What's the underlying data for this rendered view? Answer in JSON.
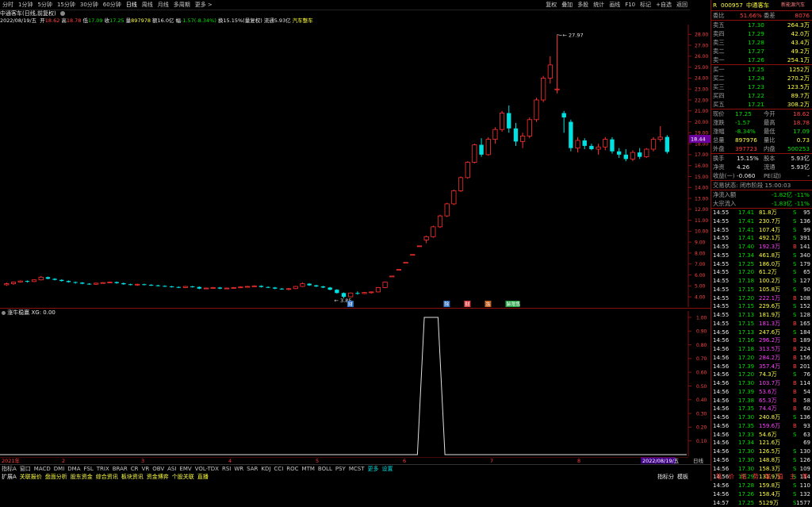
{
  "top_tabs": [
    "分时",
    "1分钟",
    "5分钟",
    "15分钟",
    "30分钟",
    "60分钟",
    "日线",
    "周线",
    "月线",
    "多周期",
    "更多 >"
  ],
  "toolbar": [
    "复权",
    "叠加",
    "多股",
    "统计",
    "画线",
    "F10",
    "标记",
    "+自选",
    "返回"
  ],
  "chart_title": "中通客车(日线,前复权)",
  "info_date": "2022/08/19/五",
  "info_items": [
    {
      "label": "开",
      "value": "18.62",
      "color": "red"
    },
    {
      "label": "高",
      "value": "18.78",
      "color": "red"
    },
    {
      "label": "低",
      "value": "17.09",
      "color": "green"
    },
    {
      "label": "收",
      "value": "17.25",
      "color": "green"
    },
    {
      "label": "量",
      "value": "897978",
      "color": "yellow"
    },
    {
      "label": "额",
      "value": "16.0亿",
      "color": "white"
    },
    {
      "label": "幅",
      "value": "-1.57(-8.34%)",
      "color": "green"
    },
    {
      "label": "换",
      "value": "15.15%(量复权)",
      "color": "white"
    },
    {
      "label": "流通",
      "value": "5.93亿",
      "color": "white"
    },
    {
      "label": "",
      "value": "汽车整车",
      "color": "yellow"
    }
  ],
  "price_axis": [
    "28.00",
    "27.00",
    "26.00",
    "25.00",
    "24.00",
    "23.00",
    "22.00",
    "21.00",
    "20.00",
    "19.00",
    "18.00",
    "17.00",
    "16.00",
    "15.00",
    "14.00",
    "13.00",
    "12.00",
    "11.00",
    "10.00",
    "9.00",
    "8.00",
    "7.00",
    "6.00",
    "5.00",
    "4.00"
  ],
  "current_price_tag": "18.44",
  "max_price_label": "27.97",
  "min_price_label": "3.85",
  "event_markers": [
    "财",
    "除",
    "财",
    "冻",
    "解限售"
  ],
  "indicator": {
    "name": "涨牛稳赢",
    "value": "XG: 0.00",
    "axis": [
      "1.00",
      "0.90",
      "0.80",
      "0.70",
      "0.60",
      "0.50",
      "0.40",
      "0.30",
      "0.20",
      "0.10"
    ]
  },
  "x_axis_labels": [
    "2021年",
    "2",
    "3",
    "4",
    "5",
    "6",
    "7",
    "8"
  ],
  "x_axis_current": "2022/08/19/五",
  "indicator_tabs": [
    "指标A",
    "窗口",
    "MACD",
    "DMI",
    "DMA",
    "FSL",
    "TRIX",
    "BRAR",
    "CR",
    "VR",
    "OBV",
    "ASI",
    "EMV",
    "VOL-TDX",
    "RSI",
    "WR",
    "SAR",
    "KDJ",
    "CCI",
    "ROC",
    "MTM",
    "BOLL",
    "PSY",
    "MCST",
    "更多",
    "设置"
  ],
  "bottom_tabs": [
    "扩展A",
    "关联报价",
    "盘面分析",
    "股东资金",
    "综合资讯",
    "板块资讯",
    "资金博弈",
    "个股关联",
    "直播"
  ],
  "bottom_right": [
    "指标分",
    "模板"
  ],
  "right_panel": {
    "code": "000957",
    "name": "中通客车",
    "sector": "新能源汽车",
    "weibi": {
      "label": "委比",
      "value": "51.66%",
      "label2": "委差",
      "value2": "8076"
    },
    "asks": [
      {
        "label": "卖五",
        "price": "17.30",
        "vol": "264.3万"
      },
      {
        "label": "卖四",
        "price": "17.29",
        "vol": "42.0万"
      },
      {
        "label": "卖三",
        "price": "17.28",
        "vol": "43.4万"
      },
      {
        "label": "卖二",
        "price": "17.27",
        "vol": "49.2万"
      },
      {
        "label": "卖一",
        "price": "17.26",
        "vol": "254.1万"
      }
    ],
    "bids": [
      {
        "label": "买一",
        "price": "17.25",
        "vol": "1252万"
      },
      {
        "label": "买二",
        "price": "17.24",
        "vol": "270.2万"
      },
      {
        "label": "买三",
        "price": "17.23",
        "vol": "123.5万"
      },
      {
        "label": "买四",
        "price": "17.22",
        "vol": "89.7万"
      },
      {
        "label": "买五",
        "price": "17.21",
        "vol": "308.2万"
      }
    ],
    "stats": [
      {
        "l1": "现价",
        "v1": "17.25",
        "c1": "green",
        "l2": "今开",
        "v2": "18.62",
        "c2": "red"
      },
      {
        "l1": "涨跌",
        "v1": "-1.57",
        "c1": "green",
        "l2": "最高",
        "v2": "18.78",
        "c2": "red"
      },
      {
        "l1": "涨幅",
        "v1": "-8.34%",
        "c1": "green",
        "l2": "最低",
        "v2": "17.09",
        "c2": "green"
      },
      {
        "l1": "总量",
        "v1": "897976",
        "c1": "yellow",
        "l2": "量比",
        "v2": "0.73",
        "c2": "yellow"
      },
      {
        "l1": "外盘",
        "v1": "397723",
        "c1": "red",
        "l2": "内盘",
        "v2": "500253",
        "c2": "green"
      }
    ],
    "stats2": [
      {
        "l1": "换手",
        "v1": "15.15%",
        "l2": "股本",
        "v2": "5.93亿"
      },
      {
        "l1": "净资",
        "v1": "4.26",
        "l2": "流通",
        "v2": "5.93亿"
      },
      {
        "l1": "收益(一)",
        "v1": "-0.060",
        "l2": "PE(动)",
        "v2": "-"
      }
    ],
    "trade_status": "交易状态: 闭市阶段 15:00:03",
    "flows": [
      {
        "label": "净流入额",
        "v1": "-1.82亿",
        "v2": "-11%"
      },
      {
        "label": "大宗流入",
        "v1": "-1.83亿",
        "v2": "-11%"
      }
    ],
    "ticks": [
      {
        "t": "14:55",
        "p": "17.41",
        "v": "81.8万",
        "s": "S",
        "n": "95"
      },
      {
        "t": "14:55",
        "p": "17.41",
        "v": "230.7万",
        "s": "S",
        "n": "136"
      },
      {
        "t": "14:55",
        "p": "17.41",
        "v": "107.4万",
        "s": "S",
        "n": "99"
      },
      {
        "t": "14:55",
        "p": "17.41",
        "v": "492.1万",
        "s": "S",
        "n": "391"
      },
      {
        "t": "14:55",
        "p": "17.40",
        "v": "192.3万",
        "s": "B",
        "n": "141"
      },
      {
        "t": "14:55",
        "p": "17.34",
        "v": "461.8万",
        "s": "S",
        "n": "340"
      },
      {
        "t": "14:55",
        "p": "17.25",
        "v": "186.0万",
        "s": "S",
        "n": "179"
      },
      {
        "t": "14:55",
        "p": "17.20",
        "v": "61.2万",
        "s": "S",
        "n": "65"
      },
      {
        "t": "14:55",
        "p": "17.18",
        "v": "100.2万",
        "s": "S",
        "n": "127"
      },
      {
        "t": "14:55",
        "p": "17.15",
        "v": "105.8万",
        "s": "S",
        "n": "90"
      },
      {
        "t": "14:55",
        "p": "17.20",
        "v": "222.1万",
        "s": "B",
        "n": "108"
      },
      {
        "t": "14:55",
        "p": "17.15",
        "v": "229.6万",
        "s": "S",
        "n": "152"
      },
      {
        "t": "14:55",
        "p": "17.13",
        "v": "181.9万",
        "s": "S",
        "n": "128"
      },
      {
        "t": "14:55",
        "p": "17.15",
        "v": "181.3万",
        "s": "B",
        "n": "165"
      },
      {
        "t": "14:56",
        "p": "17.13",
        "v": "247.6万",
        "s": "S",
        "n": "184"
      },
      {
        "t": "14:56",
        "p": "17.16",
        "v": "296.2万",
        "s": "B",
        "n": "189"
      },
      {
        "t": "14:56",
        "p": "17.18",
        "v": "313.5万",
        "s": "B",
        "n": "224"
      },
      {
        "t": "14:56",
        "p": "17.20",
        "v": "284.2万",
        "s": "B",
        "n": "156"
      },
      {
        "t": "14:56",
        "p": "17.39",
        "v": "357.4万",
        "s": "B",
        "n": "201"
      },
      {
        "t": "14:56",
        "p": "17.20",
        "v": "74.3万",
        "s": "S",
        "n": "76"
      },
      {
        "t": "14:56",
        "p": "17.30",
        "v": "103.7万",
        "s": "B",
        "n": "114"
      },
      {
        "t": "14:56",
        "p": "17.39",
        "v": "53.6万",
        "s": "B",
        "n": "54"
      },
      {
        "t": "14:56",
        "p": "17.38",
        "v": "65.3万",
        "s": "B",
        "n": "58"
      },
      {
        "t": "14:56",
        "p": "17.35",
        "v": "74.4万",
        "s": "B",
        "n": "60"
      },
      {
        "t": "14:56",
        "p": "17.30",
        "v": "240.8万",
        "s": "S",
        "n": "136"
      },
      {
        "t": "14:56",
        "p": "17.35",
        "v": "159.6万",
        "s": "B",
        "n": "93"
      },
      {
        "t": "14:56",
        "p": "17.33",
        "v": "54.6万",
        "s": "S",
        "n": "63"
      },
      {
        "t": "14:56",
        "p": "17.34",
        "v": "121.6万",
        "s": "",
        "n": "69"
      },
      {
        "t": "14:56",
        "p": "17.30",
        "v": "126.5万",
        "s": "S",
        "n": "130"
      },
      {
        "t": "14:56",
        "p": "17.30",
        "v": "148.8万",
        "s": "S",
        "n": "126"
      },
      {
        "t": "14:56",
        "p": "17.30",
        "v": "158.3万",
        "s": "S",
        "n": "109"
      },
      {
        "t": "14:56",
        "p": "17.29",
        "v": "131.9万",
        "s": "S",
        "n": "114"
      },
      {
        "t": "14:56",
        "p": "17.28",
        "v": "159.8万",
        "s": "S",
        "n": "110"
      },
      {
        "t": "14:56",
        "p": "17.26",
        "v": "158.4万",
        "s": "S",
        "n": "132"
      },
      {
        "t": "14:57",
        "p": "17.25",
        "v": "5129万",
        "s": "S",
        "n": "1577"
      }
    ],
    "bottom_tabs": [
      "笔",
      "价",
      "细",
      "势",
      "联",
      "值",
      "主",
      "筹"
    ]
  },
  "chart_data": {
    "type": "candlestick",
    "title": "中通客车(日线,前复权)",
    "ylim": [
      3.5,
      28.6
    ],
    "candles": [
      [
        5.1,
        5.3,
        5.0,
        5.2
      ],
      [
        5.2,
        5.4,
        5.1,
        5.35
      ],
      [
        5.35,
        5.5,
        5.3,
        5.45
      ],
      [
        5.45,
        5.5,
        5.3,
        5.4
      ],
      [
        5.4,
        5.6,
        5.35,
        5.55
      ],
      [
        5.55,
        5.9,
        5.5,
        5.8
      ],
      [
        5.8,
        5.85,
        5.6,
        5.65
      ],
      [
        5.65,
        5.7,
        5.5,
        5.55
      ],
      [
        5.55,
        5.6,
        5.4,
        5.45
      ],
      [
        5.45,
        5.5,
        5.3,
        5.35
      ],
      [
        5.35,
        5.4,
        5.2,
        5.3
      ],
      [
        5.3,
        5.35,
        5.15,
        5.2
      ],
      [
        5.2,
        5.25,
        5.1,
        5.15
      ],
      [
        5.15,
        5.3,
        5.1,
        5.25
      ],
      [
        5.25,
        5.35,
        5.2,
        5.3
      ],
      [
        5.3,
        5.4,
        5.25,
        5.35
      ],
      [
        5.35,
        5.4,
        5.2,
        5.25
      ],
      [
        5.25,
        5.3,
        5.1,
        5.15
      ],
      [
        5.15,
        5.2,
        5.05,
        5.1
      ],
      [
        5.1,
        5.2,
        5.0,
        5.15
      ],
      [
        5.15,
        5.2,
        5.05,
        5.1
      ],
      [
        5.1,
        5.15,
        5.0,
        5.05
      ],
      [
        5.05,
        5.1,
        4.95,
        5.0
      ],
      [
        5.0,
        5.05,
        4.9,
        4.95
      ],
      [
        4.95,
        5.0,
        4.85,
        4.9
      ],
      [
        4.9,
        4.95,
        4.8,
        4.85
      ],
      [
        4.85,
        5.0,
        4.8,
        4.95
      ],
      [
        4.95,
        5.0,
        4.85,
        4.9
      ],
      [
        4.9,
        4.95,
        4.7,
        4.75
      ],
      [
        4.75,
        4.85,
        4.7,
        4.8
      ],
      [
        4.8,
        4.9,
        4.75,
        4.85
      ],
      [
        4.85,
        4.9,
        4.7,
        4.75
      ],
      [
        4.75,
        4.85,
        4.7,
        4.8
      ],
      [
        4.8,
        4.9,
        4.75,
        4.85
      ],
      [
        4.85,
        4.95,
        4.8,
        4.9
      ],
      [
        4.9,
        5.0,
        4.85,
        4.95
      ],
      [
        4.95,
        5.05,
        4.9,
        5.0
      ],
      [
        5.0,
        5.05,
        4.85,
        4.9
      ],
      [
        4.9,
        4.95,
        4.8,
        4.85
      ],
      [
        4.85,
        4.9,
        4.7,
        4.75
      ],
      [
        4.75,
        4.8,
        4.65,
        4.7
      ],
      [
        4.7,
        4.8,
        4.6,
        4.75
      ],
      [
        4.75,
        5.0,
        4.7,
        4.95
      ],
      [
        4.95,
        5.3,
        4.9,
        5.2
      ],
      [
        5.2,
        5.25,
        5.0,
        5.05
      ],
      [
        5.05,
        5.1,
        4.9,
        4.95
      ],
      [
        4.95,
        5.0,
        4.8,
        4.85
      ],
      [
        4.85,
        4.9,
        4.6,
        4.65
      ],
      [
        4.65,
        4.7,
        4.3,
        4.35
      ],
      [
        4.35,
        4.4,
        3.85,
        4.0
      ],
      [
        4.0,
        4.4,
        3.95,
        4.35
      ],
      [
        4.35,
        4.5,
        4.2,
        4.3
      ],
      [
        4.3,
        4.45,
        4.25,
        4.4
      ],
      [
        4.4,
        4.5,
        4.3,
        4.45
      ],
      [
        4.45,
        4.9,
        4.4,
        4.85
      ],
      [
        4.85,
        5.4,
        4.8,
        5.35
      ],
      [
        5.9,
        5.9,
        5.9,
        5.9
      ],
      [
        6.5,
        6.5,
        6.5,
        6.5
      ],
      [
        7.15,
        7.15,
        7.15,
        7.15
      ],
      [
        7.87,
        7.87,
        7.87,
        7.87
      ],
      [
        8.66,
        8.66,
        8.66,
        8.66
      ],
      [
        9.2,
        9.6,
        8.9,
        9.5
      ],
      [
        9.5,
        10.5,
        9.4,
        10.4
      ],
      [
        10.4,
        11.5,
        10.3,
        11.4
      ],
      [
        11.4,
        12.6,
        11.3,
        12.5
      ],
      [
        12.5,
        13.8,
        12.4,
        13.7
      ],
      [
        13.7,
        15.0,
        13.6,
        14.9
      ],
      [
        14.9,
        16.4,
        14.8,
        16.3
      ],
      [
        16.3,
        18.0,
        16.2,
        17.9
      ],
      [
        17.9,
        18.5,
        16.8,
        17.0
      ],
      [
        17.0,
        18.6,
        16.9,
        18.4
      ],
      [
        18.4,
        19.5,
        18.0,
        19.3
      ],
      [
        19.3,
        21.0,
        19.1,
        20.8
      ],
      [
        20.8,
        21.5,
        19.0,
        19.4
      ],
      [
        19.4,
        19.9,
        17.8,
        18.2
      ],
      [
        18.2,
        19.0,
        17.6,
        18.7
      ],
      [
        18.7,
        20.4,
        18.5,
        20.2
      ],
      [
        20.2,
        22.2,
        20.0,
        22.0
      ],
      [
        22.0,
        24.2,
        21.8,
        24.0
      ],
      [
        24.0,
        26.0,
        23.5,
        25.2
      ],
      [
        23.0,
        27.97,
        22.6,
        23.0
      ],
      [
        20.8,
        21.0,
        19.0,
        20.4
      ],
      [
        20.0,
        20.2,
        17.3,
        17.6
      ],
      [
        17.6,
        18.6,
        17.2,
        18.3
      ],
      [
        18.3,
        18.5,
        17.5,
        17.8
      ],
      [
        17.8,
        18.0,
        17.4,
        17.5
      ],
      [
        17.5,
        18.0,
        17.0,
        17.7
      ],
      [
        17.7,
        18.6,
        17.4,
        18.4
      ],
      [
        18.4,
        18.6,
        17.1,
        17.3
      ],
      [
        17.3,
        17.6,
        16.7,
        17.0
      ],
      [
        17.0,
        17.5,
        16.4,
        16.6
      ],
      [
        16.6,
        17.4,
        16.4,
        17.2
      ],
      [
        17.2,
        17.6,
        16.6,
        16.8
      ],
      [
        16.8,
        17.6,
        16.7,
        17.5
      ],
      [
        17.5,
        18.6,
        17.3,
        18.4
      ],
      [
        18.4,
        19.6,
        18.2,
        18.6
      ],
      [
        18.62,
        18.78,
        17.09,
        17.25
      ]
    ],
    "indicator_signal": {
      "name": "XG",
      "values_active_range": [
        "2022-05-11",
        "2022-05-17"
      ],
      "ylim": [
        0,
        1
      ]
    }
  }
}
